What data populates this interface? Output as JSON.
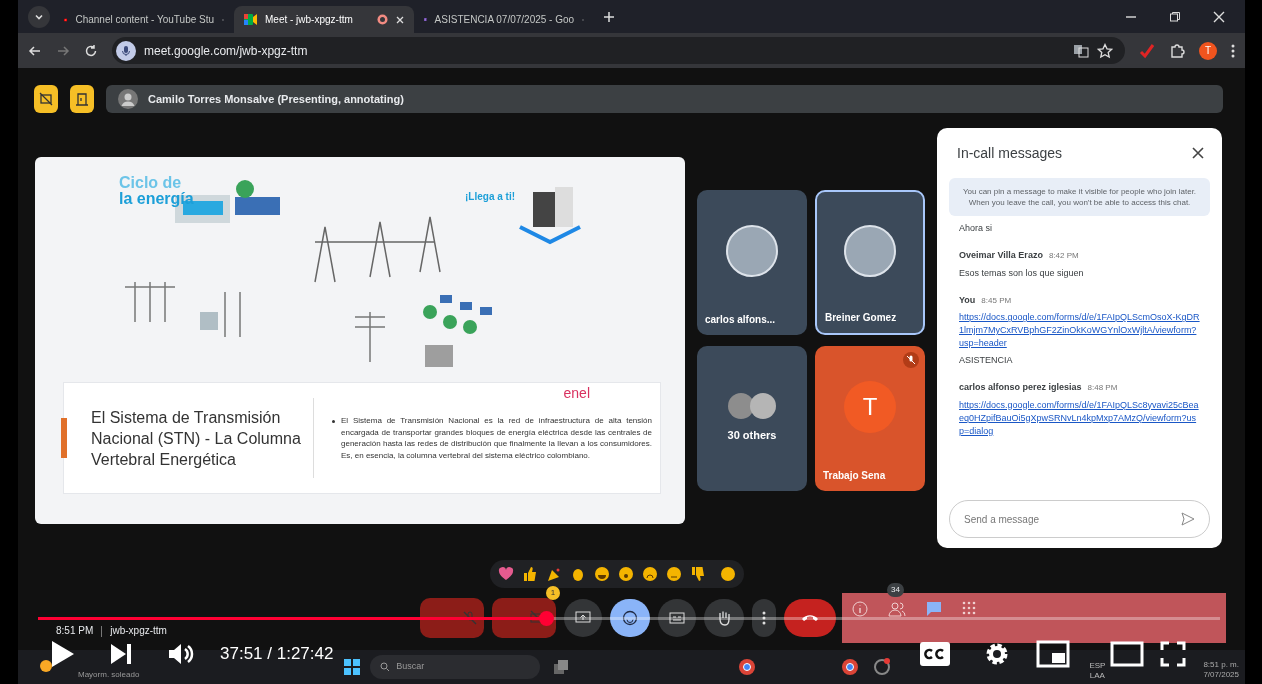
{
  "browser": {
    "tabs": [
      {
        "kind": "youtube",
        "title": "Channel content - YouTube Stu",
        "selected": false,
        "recording": false
      },
      {
        "kind": "meet",
        "title": "Meet - jwb-xpgz-ttm",
        "selected": true,
        "recording": true
      },
      {
        "kind": "forms",
        "title": "ASISTENCIA 07/07/2025 - Goo",
        "selected": false,
        "recording": false
      }
    ],
    "url": "meet.google.com/jwb-xpgz-ttm",
    "profile_initial": "T"
  },
  "meet": {
    "presenter": "Camilo Torres Monsalve (Presenting, annotating)",
    "slide": {
      "heading_top": "Ciclo de",
      "heading_bottom": "la energía",
      "callout": "¡Llega a ti!",
      "logo": "enel",
      "title": "El Sistema de Transmisión Nacional (STN) - La Columna Vertebral Energética",
      "bullet": "El Sistema de Transmisión Nacional es la red de infraestructura de alta tensión encargada de transportar grandes bloques de energía eléctrica desde las centrales de generación hasta las redes de distribución que finalmente la llevan a los consumidores. Es, en esencia, la columna vertebral del sistema eléctrico colombiano."
    },
    "participants": [
      {
        "kind": "avatar",
        "name": "carlos alfons...",
        "highlighted": false,
        "muted": false
      },
      {
        "kind": "avatar",
        "name": "Breiner Gomez",
        "highlighted": true,
        "muted": false
      },
      {
        "kind": "group",
        "name": "30 others",
        "highlighted": false,
        "muted": false
      },
      {
        "kind": "initial",
        "name": "Trabajo Sena",
        "letter": "T",
        "highlighted": false,
        "muted": true
      }
    ],
    "chat": {
      "title": "In-call messages",
      "notice": "You can pin a message to make it visible for people who join later. When you leave the call, you won't be able to access this chat.",
      "items": [
        {
          "kind": "text",
          "text": "Ahora si"
        },
        {
          "kind": "sender",
          "name": "Oveimar Villa Erazo",
          "time": "8:42 PM"
        },
        {
          "kind": "text",
          "text": "Esos temas son los que siguen"
        },
        {
          "kind": "sender",
          "name": "You",
          "time": "8:45 PM"
        },
        {
          "kind": "link",
          "text": "https://docs.google.com/forms/d/e/1FAIpQLScmOsoX-KgDR1lmjm7MyCxRVBphGF2ZinOkKoWGYnlOxWjltA/viewform?usp=header"
        },
        {
          "kind": "text",
          "text": "ASISTENCIA"
        },
        {
          "kind": "sender",
          "name": "carlos alfonso perez iglesias",
          "time": "8:48 PM"
        },
        {
          "kind": "link",
          "text": "https://docs.google.com/forms/d/e/1FAIpQLSc8yvavi25cBeaeq0HZpifBauOi5gXpwSRNvLn4kpMxp7AMzQ/viewform?usp=dialog"
        }
      ],
      "placeholder": "Send a message"
    },
    "meeting_time": "8:51 PM",
    "meeting_code": "jwb-xpgz-ttm",
    "controls": {
      "mic_on": false,
      "camera_on": false,
      "camera_badge": "1",
      "people_count": "34",
      "chat_open": true
    }
  },
  "player": {
    "time": "37:51 / 1:27:42",
    "progress": {
      "level": 0.43
    }
  },
  "taskbar": {
    "weather": "Mayorm. soleado",
    "search_placeholder": "Buscar",
    "language": [
      "ESP",
      "LAA"
    ],
    "clock": "8:51 p. m.",
    "date": "7/07/2025"
  }
}
